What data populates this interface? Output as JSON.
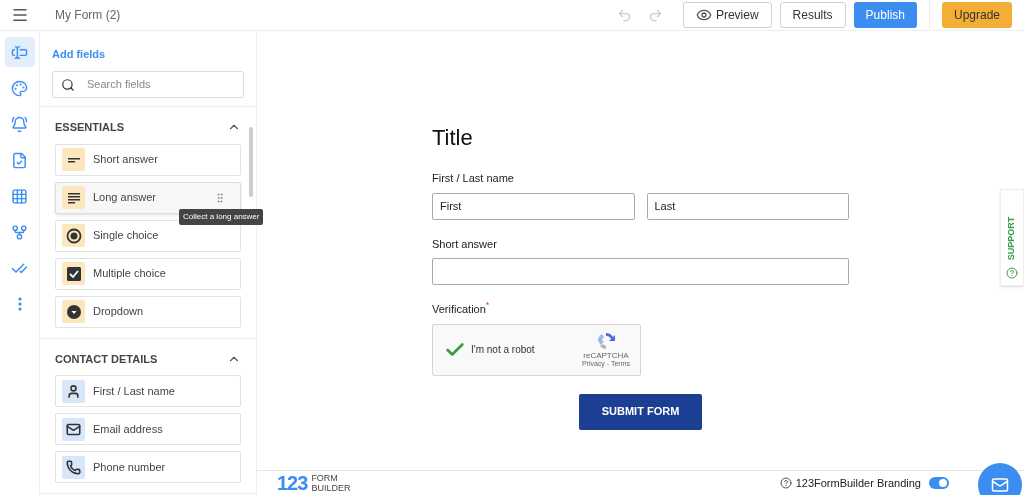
{
  "header": {
    "title": "My Form (2)",
    "buttons": [
      {
        "label": "Preview",
        "kind": "outline-icon"
      },
      {
        "label": "Results",
        "kind": "outline"
      },
      {
        "label": "Publish",
        "kind": "primary"
      },
      {
        "label": "Upgrade",
        "kind": "upgrade"
      }
    ]
  },
  "rail": {
    "items": [
      {
        "selected": true
      },
      {
        "selected": false
      },
      {
        "selected": false
      },
      {
        "selected": false
      },
      {
        "selected": false
      },
      {
        "selected": false
      },
      {
        "selected": false
      },
      {
        "selected": false
      }
    ]
  },
  "panel": {
    "title": "Add fields",
    "search": {
      "placeholder": "Search fields"
    },
    "sections": [
      {
        "title": "ESSENTIALS",
        "expanded": true,
        "color": "#fbe6bd",
        "items": [
          {
            "label": "Short answer",
            "hovered": false
          },
          {
            "label": "Long answer",
            "hovered": true,
            "tooltip": "Collect a long answer"
          },
          {
            "label": "Single choice",
            "hovered": false
          },
          {
            "label": "Multiple choice",
            "hovered": false
          },
          {
            "label": "Dropdown",
            "hovered": false
          }
        ]
      },
      {
        "title": "CONTACT DETAILS",
        "expanded": true,
        "color": "#d7e6f8",
        "items": [
          {
            "label": "First / Last name",
            "hovered": false
          },
          {
            "label": "Email address",
            "hovered": false
          },
          {
            "label": "Phone number",
            "hovered": false
          }
        ]
      }
    ]
  },
  "form": {
    "title": "Title",
    "required_mark": "*",
    "fields": [
      {
        "kind": "name",
        "label": "First / Last name",
        "required": false,
        "values": [
          "First",
          "Last"
        ]
      },
      {
        "kind": "text",
        "label": "Short answer",
        "required": false
      },
      {
        "kind": "captcha",
        "label": "Verification",
        "required": true,
        "checked": true,
        "text": "I'm not a robot",
        "brand": "reCAPTCHA",
        "links": "Privacy - Terms"
      }
    ],
    "submit": "SUBMIT FORM"
  },
  "support": {
    "label": "SUPPORT"
  },
  "footer": {
    "logo_digits": "123",
    "logo_words": [
      "FORM",
      "BUILDER"
    ],
    "branding": {
      "label": "123FormBuilder Branding",
      "on": true
    }
  }
}
